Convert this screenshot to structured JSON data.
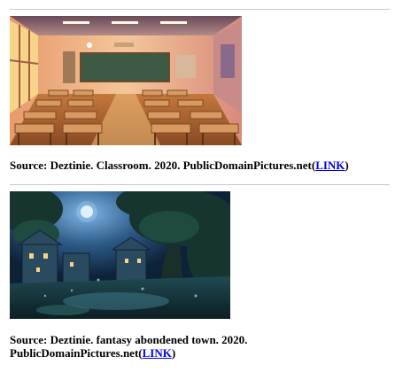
{
  "figures": [
    {
      "image_name": "classroom-painting",
      "caption_prefix": "Source: Deztinie. Classroom. 2020. PublicDomainPictures.net(",
      "link_text": "LINK",
      "caption_suffix": ")"
    },
    {
      "image_name": "fantasy-town-painting",
      "caption_prefix": "Source: Deztinie. fantasy abondened town. 2020.",
      "caption_prefix_line2": "PublicDomainPictures.net(",
      "link_text": "LINK",
      "caption_suffix": ")"
    }
  ]
}
